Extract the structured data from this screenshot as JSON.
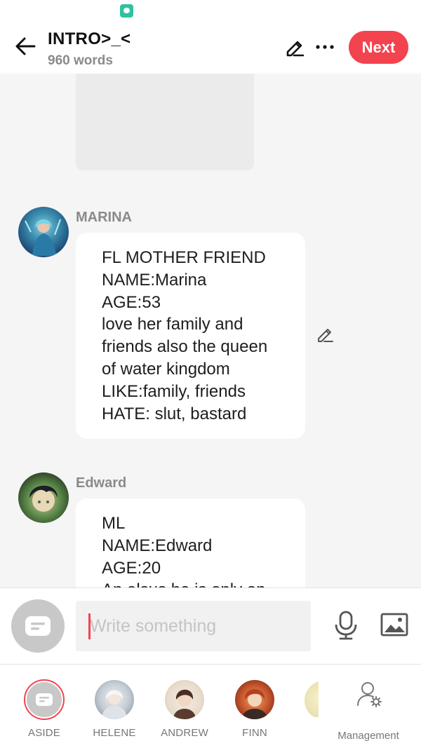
{
  "header": {
    "title": "INTRO>_<",
    "word_count": "960 words",
    "next_label": "Next"
  },
  "messages": [
    {
      "name": "MARINA",
      "lines": [
        "FL MOTHER FRIEND",
        "NAME:Marina",
        "AGE:53",
        "love her family and",
        "friends also the queen",
        "of water kingdom",
        "LIKE:family, friends",
        "HATE: slut, bastard"
      ]
    },
    {
      "name": "Edward",
      "lines": [
        "ML",
        "NAME:Edward",
        "AGE:20",
        "An alsus he is only on"
      ]
    }
  ],
  "composer": {
    "placeholder": "Write something"
  },
  "characters": [
    {
      "label": "ASIDE"
    },
    {
      "label": "HELENE"
    },
    {
      "label": "ANDREW"
    },
    {
      "label": "FINN"
    }
  ],
  "management_label": "Management",
  "colors": {
    "accent": "#f2434f",
    "background": "#f5f5f5",
    "muted_text": "#8a8a8a"
  }
}
